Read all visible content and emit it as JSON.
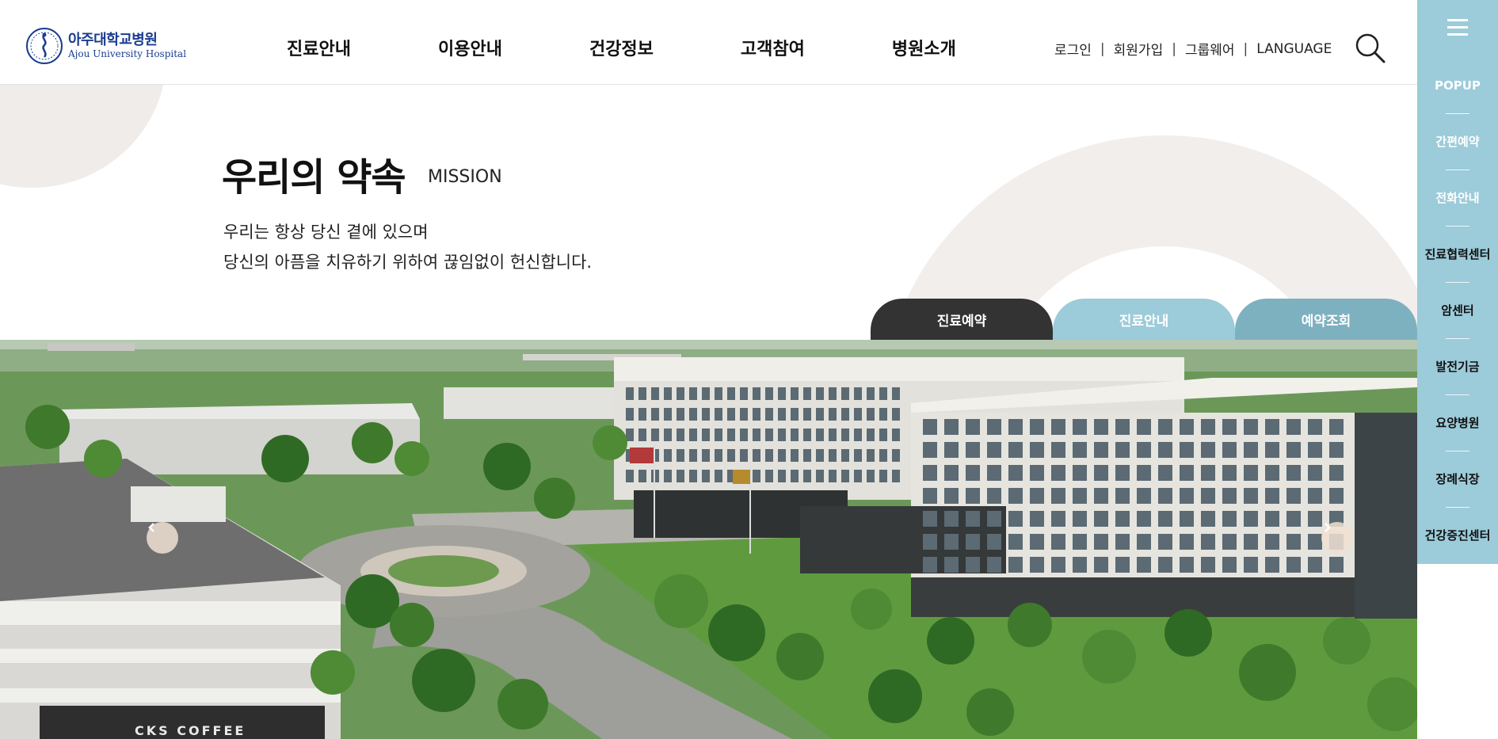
{
  "header": {
    "logo": {
      "name_kr": "아주대학교병원",
      "name_en": "Ajou University Hospital"
    },
    "nav": [
      "진료안내",
      "이용안내",
      "건강정보",
      "고객참여",
      "병원소개"
    ],
    "util": {
      "login": "로그인",
      "signup": "회원가입",
      "groupware": "그룹웨어",
      "language": "LANGUAGE"
    },
    "search_icon": "search-icon"
  },
  "mission": {
    "title": "우리의 약속",
    "subtitle": "MISSION",
    "line1": "우리는 항상 당신 곁에 있으며",
    "line2": "당신의 아픔을 치유하기 위하여 끊임없이 헌신합니다."
  },
  "tabs": [
    "진료예약",
    "진료안내",
    "예약조회"
  ],
  "quick_bar": {
    "menu_icon": "hamburger-icon",
    "items": [
      "POPUP",
      "간편예약",
      "전화안내",
      "진료협력센터",
      "암센터",
      "발전기금",
      "요양병원",
      "장례식장",
      "건강증진센터"
    ]
  },
  "hero": {
    "prev_icon": "chevron-left-icon",
    "next_icon": "chevron-right-icon",
    "sign_text": "CKS COFFEE"
  },
  "colors": {
    "brand_blue": "#1a3d8f",
    "quick_bar": "#9ccbd9",
    "tab_dark": "#333333",
    "tab_light": "#9ccbd9",
    "tab_mid": "#7eb1c0"
  }
}
